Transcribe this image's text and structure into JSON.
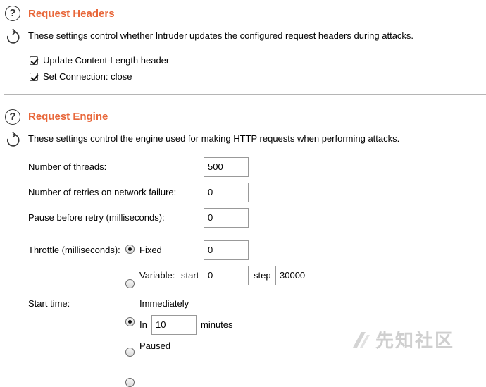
{
  "request_headers": {
    "title": "Request Headers",
    "description": "These settings control whether Intruder updates the configured request headers during attacks.",
    "update_content_length": {
      "label": "Update Content-Length header",
      "checked": true
    },
    "set_connection_close": {
      "label": "Set Connection: close",
      "checked": true
    }
  },
  "request_engine": {
    "title": "Request Engine",
    "description": "These settings control the engine used for making HTTP requests when performing attacks.",
    "threads": {
      "label": "Number of threads:",
      "value": "500"
    },
    "retries": {
      "label": "Number of retries on network failure:",
      "value": "0"
    },
    "pause_retry": {
      "label": "Pause before retry (milliseconds):",
      "value": "0"
    },
    "throttle": {
      "label": "Throttle (milliseconds):",
      "fixed_label": "Fixed",
      "fixed_value": "0",
      "variable_label": "Variable:",
      "start_label": "start",
      "start_value": "0",
      "step_label": "step",
      "step_value": "30000",
      "selected": "Fixed"
    },
    "start_time": {
      "label": "Start time:",
      "immediately_label": "Immediately",
      "in_label": "In",
      "in_value": "10",
      "minutes_label": "minutes",
      "paused_label": "Paused",
      "selected": "Immediately"
    }
  },
  "watermark": {
    "text": "先知社区"
  },
  "icons": {
    "help": "help-icon",
    "restore": "restore-defaults-icon"
  }
}
